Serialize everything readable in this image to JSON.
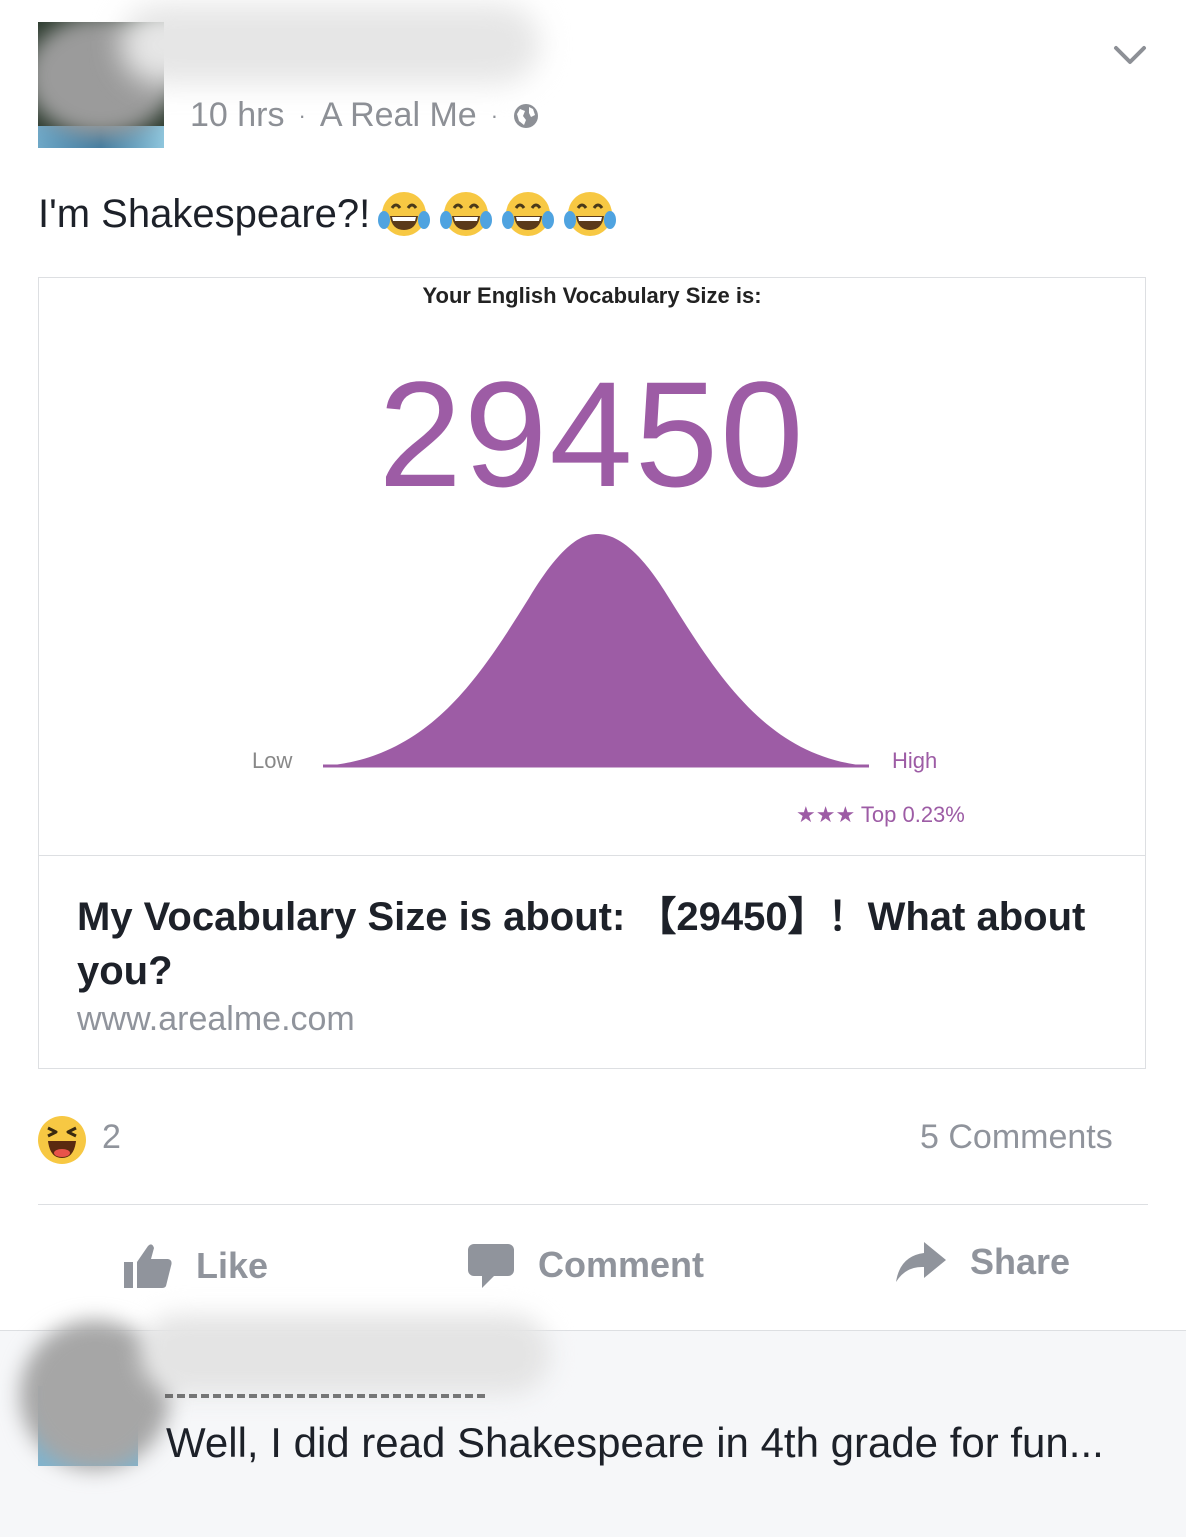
{
  "post": {
    "time": "10 hrs",
    "separator": "·",
    "app": "A Real Me",
    "text": "I'm Shakespeare?!"
  },
  "link": {
    "image_caption": "Your English Vocabulary Size is:",
    "image_score": "29450",
    "low_label": "Low",
    "high_label": "High",
    "top_label": "★★★ Top 0.23%",
    "title": "My Vocabulary Size is about: 【29450】！What about you?",
    "domain": "www.arealme.com"
  },
  "reactions": {
    "count": "2",
    "comments": "5 Comments"
  },
  "actions": {
    "like": "Like",
    "comment": "Comment",
    "share": "Share"
  },
  "comment": {
    "text": "Well, I did read Shakespeare in 4th grade for fun..."
  },
  "colors": {
    "accent_purple": "#9d5ca5",
    "muted_text": "#90949c",
    "emoji_yellow": "#f7c843"
  }
}
